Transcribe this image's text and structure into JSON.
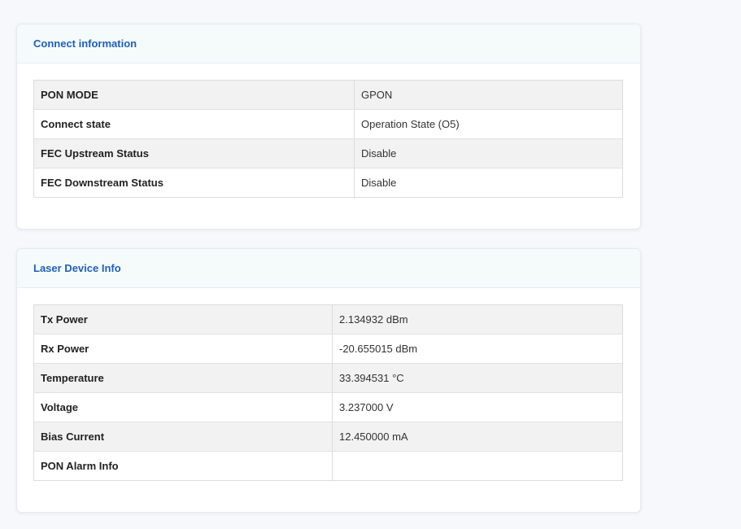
{
  "connect_info": {
    "title": "Connect information",
    "rows": [
      {
        "label": "PON MODE",
        "value": "GPON"
      },
      {
        "label": "Connect state",
        "value": "Operation State (O5)"
      },
      {
        "label": "FEC Upstream Status",
        "value": "Disable"
      },
      {
        "label": "FEC Downstream Status",
        "value": "Disable"
      }
    ]
  },
  "laser_info": {
    "title": "Laser Device Info",
    "rows": [
      {
        "label": "Tx Power",
        "value": "2.134932 dBm"
      },
      {
        "label": "Rx Power",
        "value": "-20.655015 dBm"
      },
      {
        "label": "Temperature",
        "value": "33.394531 °C"
      },
      {
        "label": "Voltage",
        "value": "3.237000 V"
      },
      {
        "label": "Bias Current",
        "value": "12.450000 mA"
      },
      {
        "label": "PON Alarm Info",
        "value": ""
      }
    ]
  },
  "colors": {
    "accent": "#1f5fbf",
    "header_bg": "#f5fbfb",
    "row_alt": "#f2f2f2"
  }
}
